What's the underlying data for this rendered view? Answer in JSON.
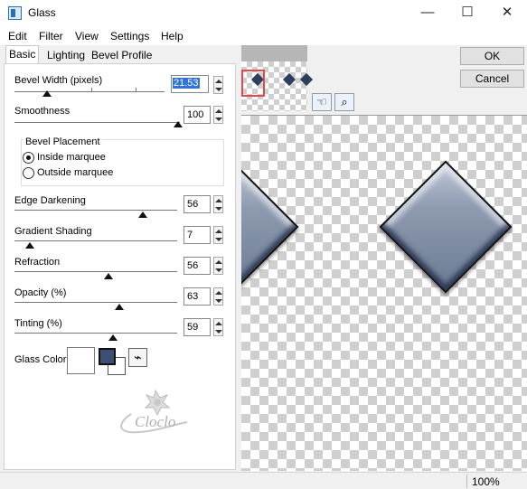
{
  "window": {
    "title": "Glass",
    "minimize_glyph": "—",
    "maximize_glyph": "☐",
    "close_glyph": "✕"
  },
  "menu": [
    "Edit",
    "Filter",
    "View",
    "Settings",
    "Help"
  ],
  "tabs": [
    "Basic",
    "Lighting",
    "Bevel Profile"
  ],
  "fields": {
    "bevel_width": {
      "label": "Bevel Width (pixels)",
      "value": "21.53"
    },
    "smoothness": {
      "label": "Smoothness",
      "value": "100"
    },
    "edge_darkening": {
      "label": "Edge Darkening",
      "value": "56"
    },
    "gradient_shading": {
      "label": "Gradient Shading",
      "value": "7"
    },
    "refraction": {
      "label": "Refraction",
      "value": "56"
    },
    "opacity": {
      "label": "Opacity (%)",
      "value": "63"
    },
    "tinting": {
      "label": "Tinting (%)",
      "value": "59"
    }
  },
  "bevel_placement": {
    "title": "Bevel Placement",
    "options": [
      "Inside marquee",
      "Outside marquee"
    ],
    "selected": "Inside marquee"
  },
  "glass_color": {
    "label": "Glass Color",
    "foreground": "#3d4f73",
    "background": "#ffffff"
  },
  "watermark": "Cloclo",
  "buttons": {
    "ok": "OK",
    "cancel": "Cancel"
  },
  "tools": [
    "hand-icon",
    "magnifier-icon"
  ],
  "status": {
    "zoom": "100%"
  },
  "colors": {
    "gem": "#8d9ab0",
    "gem_dark": "#2d3f5c",
    "nav_box": "#e04a4a"
  }
}
